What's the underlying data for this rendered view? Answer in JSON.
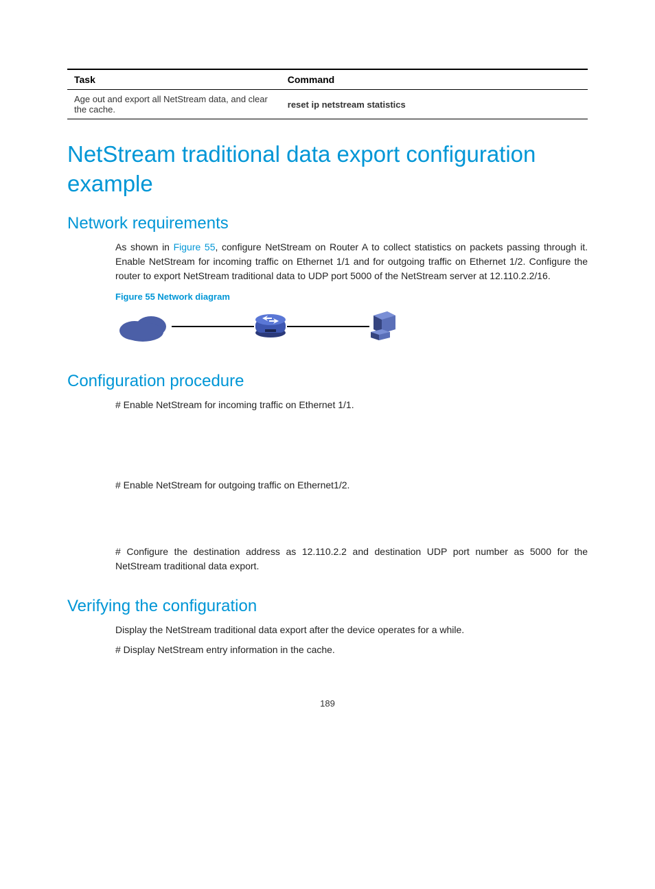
{
  "table": {
    "headers": {
      "task": "Task",
      "command": "Command"
    },
    "row": {
      "task": "Age out and export all NetStream data, and clear the cache.",
      "command": "reset ip netstream statistics"
    }
  },
  "h1": "NetStream traditional data export configuration example",
  "sections": {
    "req": {
      "title": "Network requirements",
      "intro_prefix": "As shown in ",
      "intro_link": "Figure 55",
      "intro_rest": ", configure NetStream on Router A to collect statistics on packets passing through it. Enable NetStream for incoming traffic on Ethernet 1/1 and for outgoing traffic on Ethernet 1/2. Configure the router to export NetStream traditional data to UDP port 5000 of the NetStream server at 12.110.2.2/16.",
      "fig_caption": "Figure 55 Network diagram"
    },
    "proc": {
      "title": "Configuration procedure",
      "p1": "# Enable NetStream for incoming traffic on Ethernet 1/1.",
      "p2": "# Enable NetStream for outgoing traffic on Ethernet1/2.",
      "p3": "# Configure the destination address as 12.110.2.2 and destination UDP port number as 5000 for the NetStream traditional data export."
    },
    "verify": {
      "title": "Verifying the configuration",
      "p1": "Display the NetStream traditional data export after the device operates for a while.",
      "p2": "# Display NetStream entry information in the cache."
    }
  },
  "page_number": "189"
}
